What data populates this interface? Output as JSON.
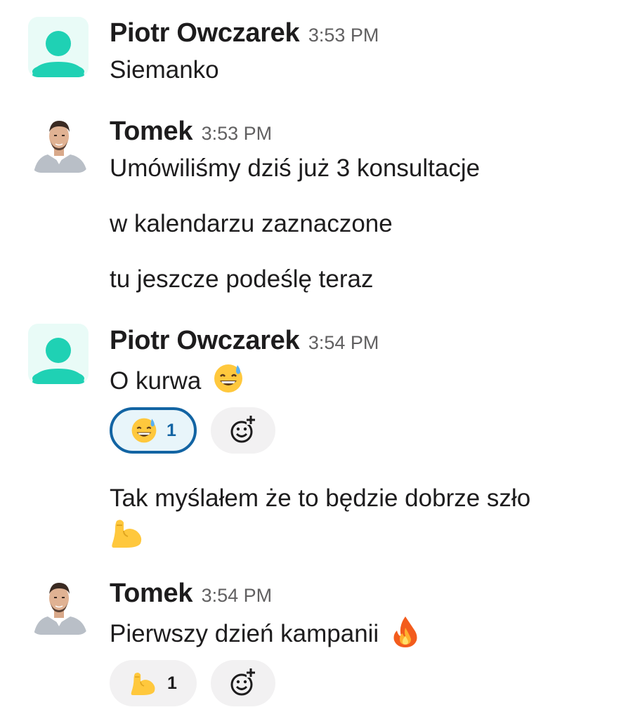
{
  "messages": [
    {
      "author": "Piotr Owczarek",
      "time": "3:53 PM",
      "avatar": "generic-user-icon",
      "lines": [
        "Siemanko"
      ]
    },
    {
      "author": "Tomek",
      "time": "3:53 PM",
      "avatar": "photo",
      "lines": [
        "Umówiliśmy dziś już 3 konsultacje",
        "w kalendarzu zaznaczone",
        "tu jeszcze podeślę teraz"
      ]
    },
    {
      "author": "Piotr Owczarek",
      "time": "3:54 PM",
      "avatar": "generic-user-icon",
      "lines": [
        "O kurwa",
        "Tak myślałem że to będzie dobrze szło"
      ],
      "reactions": [
        {
          "emoji": "sweat-smile-emoji",
          "count": "1",
          "active": true
        }
      ]
    },
    {
      "author": "Tomek",
      "time": "3:54 PM",
      "avatar": "photo",
      "lines": [
        "Pierwszy dzień kampanii"
      ],
      "reactions": [
        {
          "emoji": "flexed-biceps-emoji",
          "count": "1",
          "active": false
        }
      ]
    }
  ],
  "colors": {
    "avatar_teal": "#1fd1b4",
    "avatar_bg": "#e9fbf7",
    "active_reaction_border": "#1264a3",
    "reaction_bg": "#f2f1f2",
    "time_gray": "#616061"
  }
}
